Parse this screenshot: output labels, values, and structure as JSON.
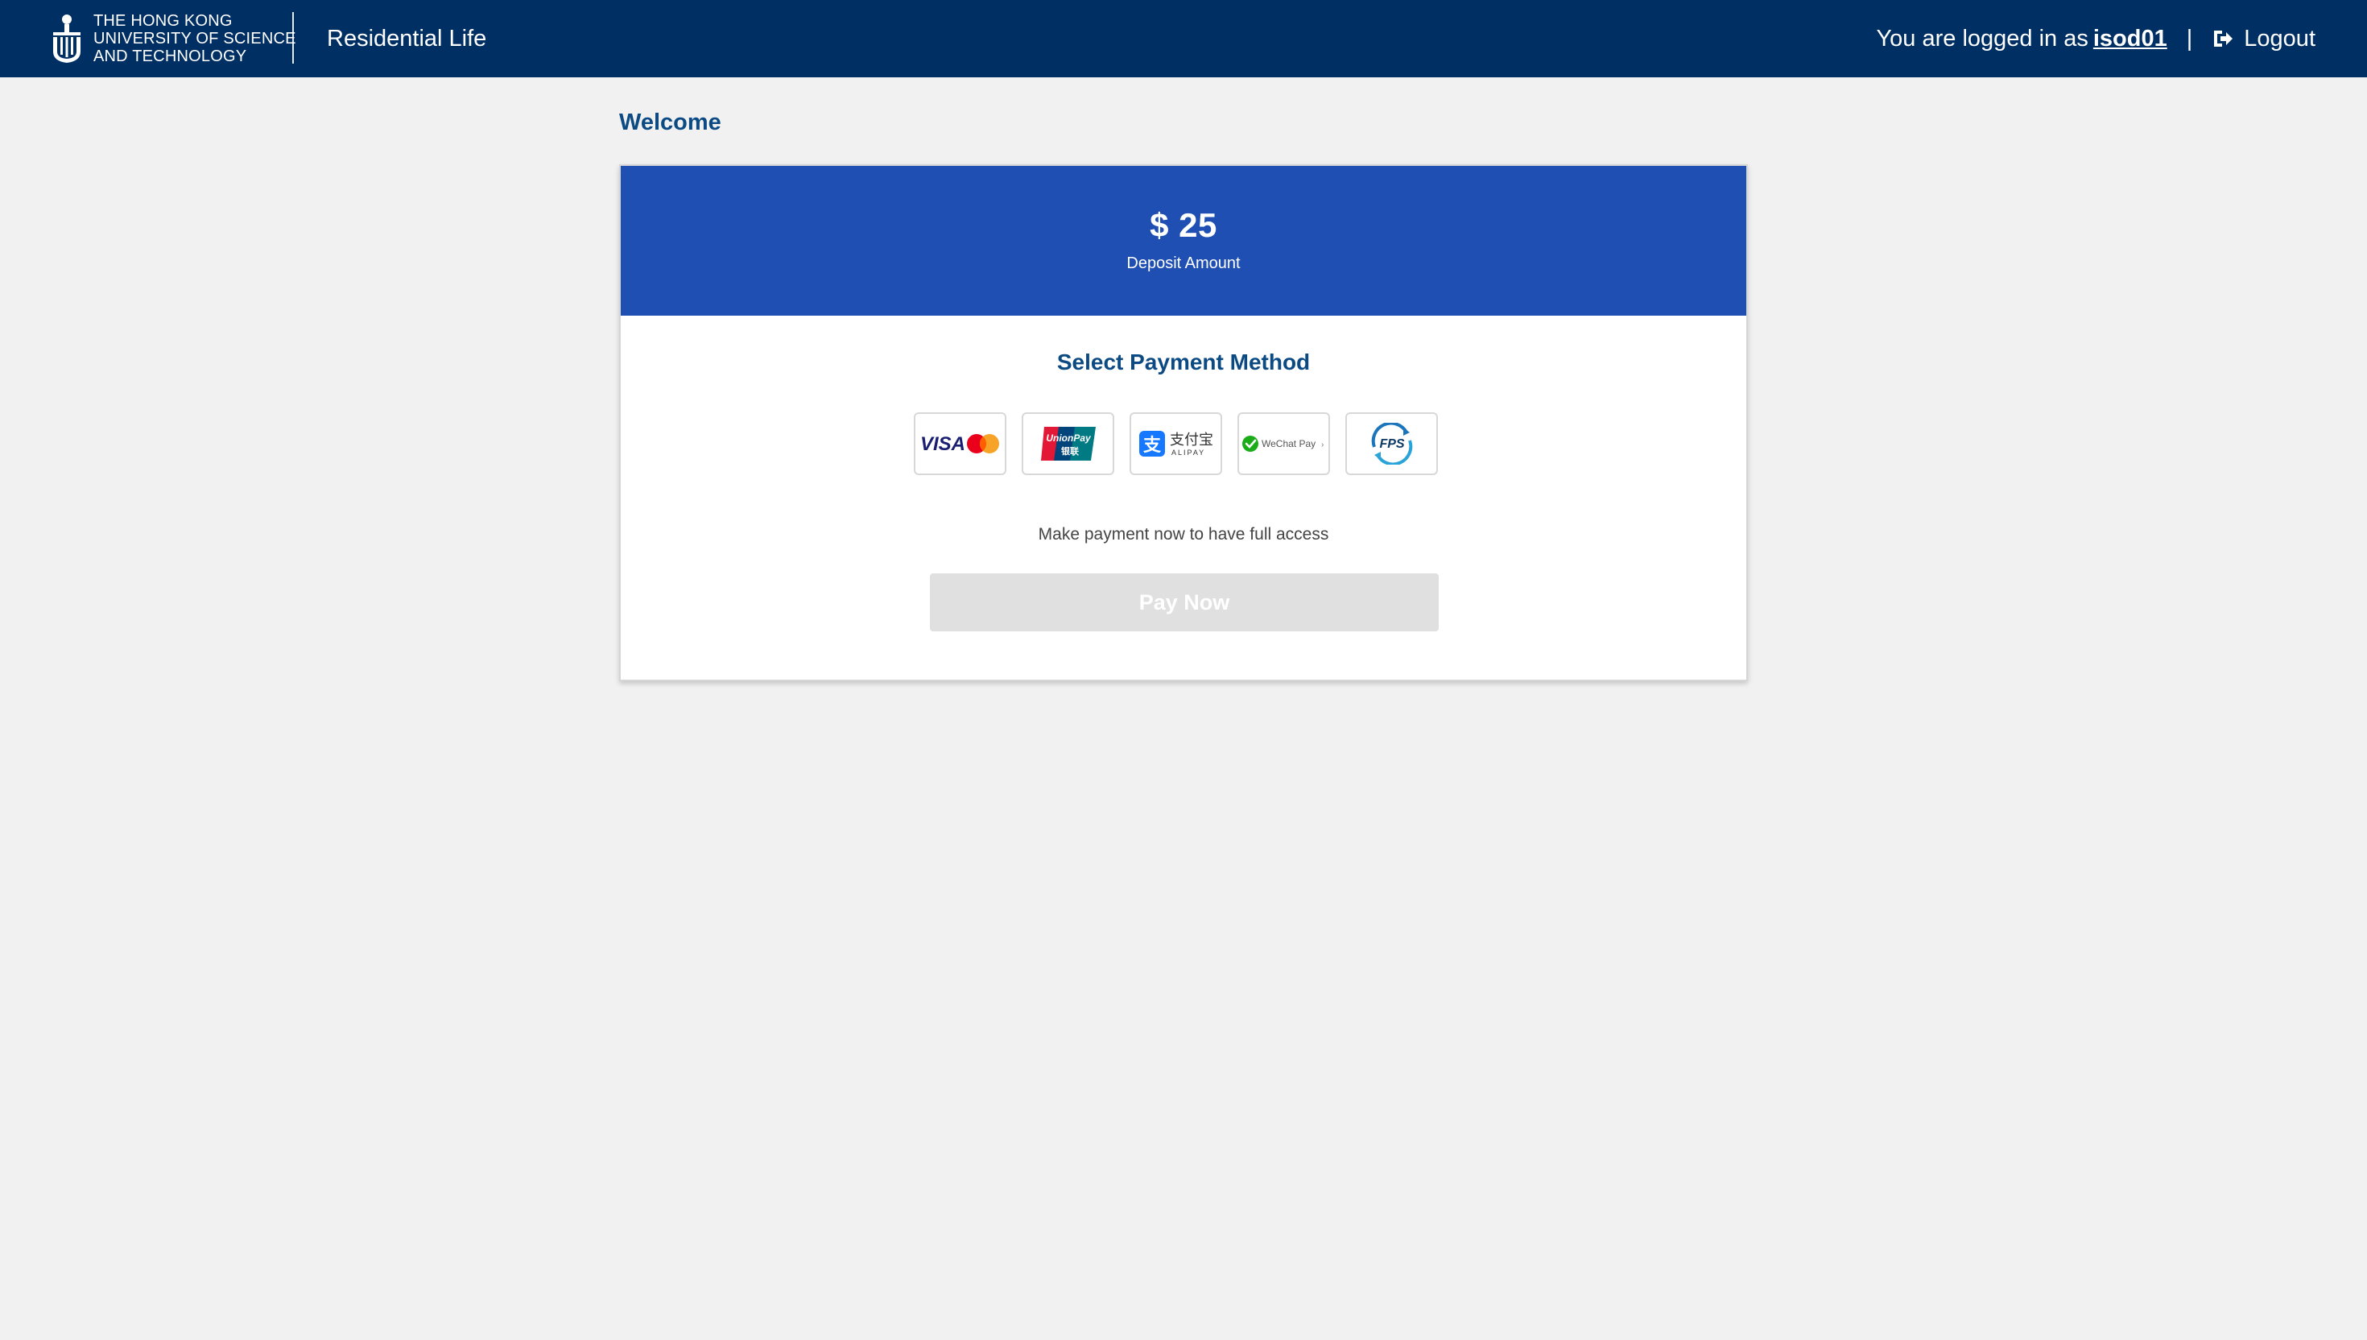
{
  "header": {
    "university_lines": [
      "THE HONG KONG",
      "UNIVERSITY OF SCIENCE",
      "AND TECHNOLOGY"
    ],
    "app_title": "Residential Life",
    "logged_in_prefix": "You are logged in as",
    "username": "isod01",
    "separator": "|",
    "logout_label": "Logout",
    "logout_icon": "sign-out-icon"
  },
  "main": {
    "welcome": "Welcome",
    "deposit": {
      "amount": "$ 25",
      "label": "Deposit Amount"
    },
    "payment": {
      "title": "Select Payment Method",
      "methods": [
        {
          "name": "VISA / Mastercard",
          "brand_text": "VISA",
          "icon": "visa-mastercard-logo"
        },
        {
          "name": "UnionPay",
          "brand_text": "UnionPay",
          "brand_text_cn": "银联",
          "icon": "unionpay-logo"
        },
        {
          "name": "Alipay",
          "brand_text": "ALIPAY",
          "brand_text_cn": "支付宝",
          "icon": "alipay-logo"
        },
        {
          "name": "WeChat Pay",
          "brand_text": "WeChat Pay",
          "icon": "wechat-pay-logo"
        },
        {
          "name": "FPS",
          "brand_text": "FPS",
          "icon": "fps-logo"
        }
      ],
      "note": "Make payment now to have full access",
      "pay_button": "Pay Now"
    }
  },
  "colors": {
    "header_bg": "#002f63",
    "banner_bg": "#1f4fb3",
    "title_blue": "#0b4a82",
    "page_bg": "#f1f1f1",
    "disabled_button": "#e0e0e0"
  }
}
